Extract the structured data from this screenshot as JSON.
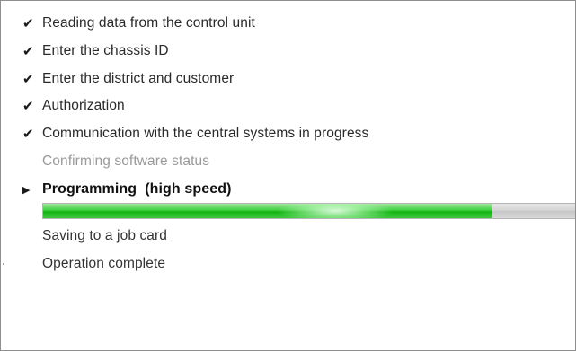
{
  "steps": [
    {
      "mark": "✔",
      "label": "Reading data from the control unit",
      "state": "done"
    },
    {
      "mark": "✔",
      "label": "Enter the chassis ID",
      "state": "done"
    },
    {
      "mark": "✔",
      "label": "Enter the district and customer",
      "state": "done"
    },
    {
      "mark": "✔",
      "label": "Authorization",
      "state": "done"
    },
    {
      "mark": "✔",
      "label": "Communication with the central systems in progress",
      "state": "done"
    },
    {
      "mark": "",
      "label": "Confirming software status",
      "state": "skipped"
    },
    {
      "mark": "▶",
      "label": "Programming  (high speed)",
      "state": "current"
    },
    {
      "mark": "",
      "label": "Saving to a job card",
      "state": "upcoming"
    },
    {
      "mark": "",
      "label": "Operation complete",
      "state": "upcoming"
    }
  ],
  "progress": {
    "fraction": 0.835,
    "fill_color": "#22c022",
    "track_color": "#d4d4d4"
  },
  "icons": {
    "done": "check-icon",
    "current": "play-arrow-icon"
  }
}
